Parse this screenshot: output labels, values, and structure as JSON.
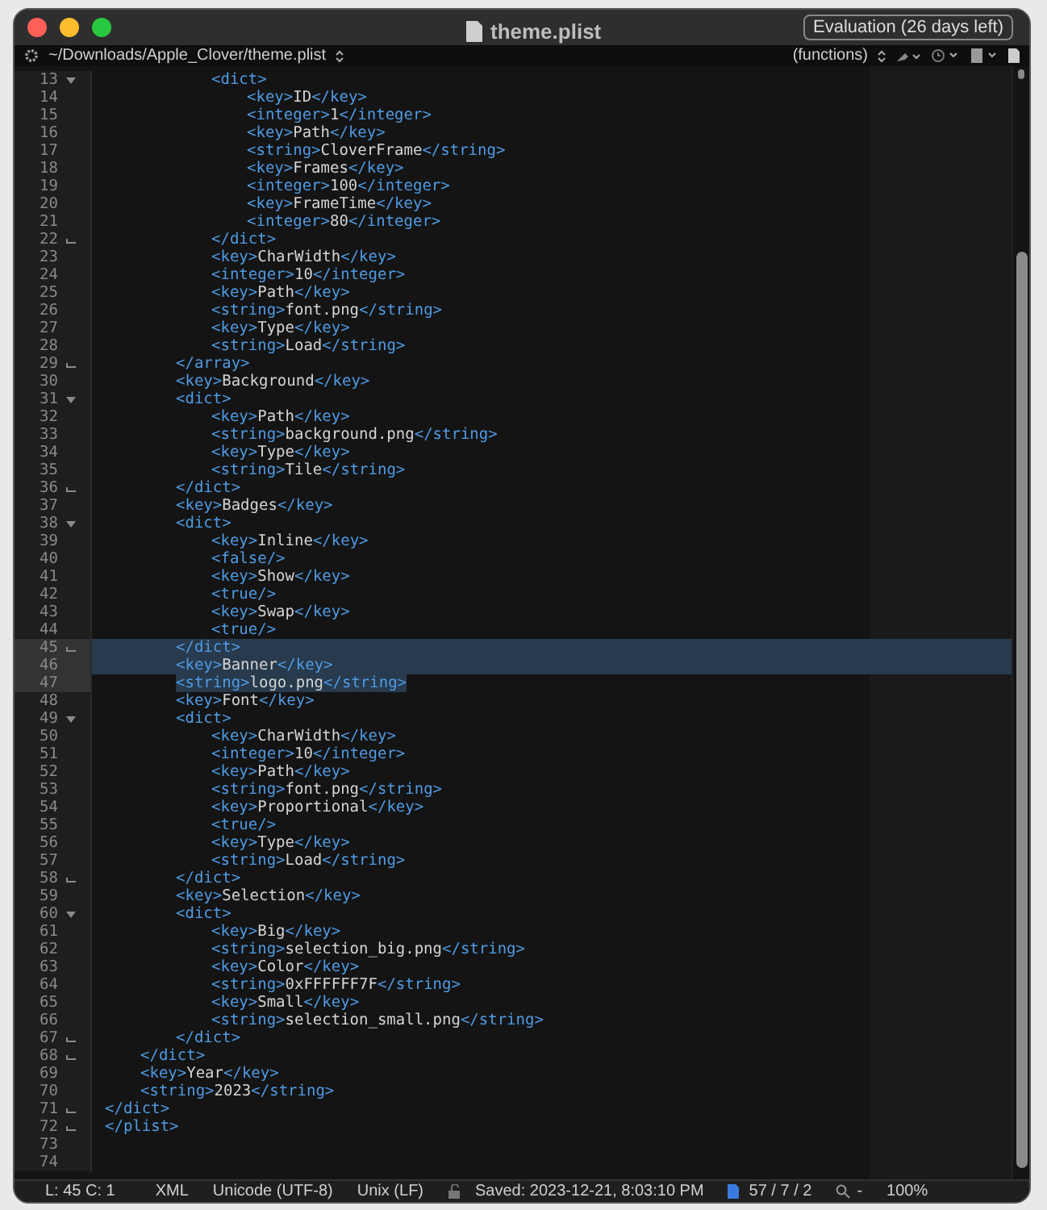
{
  "window": {
    "title": "theme.plist",
    "badge": "Evaluation (26 days left)"
  },
  "toolbar": {
    "path": "~/Downloads/Apple_Clover/theme.plist",
    "functions": "(functions)"
  },
  "lines": [
    {
      "number": "13",
      "text": "\t\t\t<dict>",
      "kind": "fold_start",
      "selected": false
    },
    {
      "number": "14",
      "text": "\t\t\t\t<key>ID</key>",
      "kind": "plain",
      "selected": false
    },
    {
      "number": "15",
      "text": "\t\t\t\t<integer>1</integer>",
      "kind": "plain",
      "selected": false
    },
    {
      "number": "16",
      "text": "\t\t\t\t<key>Path</key>",
      "kind": "plain",
      "selected": false
    },
    {
      "number": "17",
      "text": "\t\t\t\t<string>CloverFrame</string>",
      "kind": "plain",
      "selected": false
    },
    {
      "number": "18",
      "text": "\t\t\t\t<key>Frames</key>",
      "kind": "plain",
      "selected": false
    },
    {
      "number": "19",
      "text": "\t\t\t\t<integer>100</integer>",
      "kind": "plain",
      "selected": false
    },
    {
      "number": "20",
      "text": "\t\t\t\t<key>FrameTime</key>",
      "kind": "plain",
      "selected": false
    },
    {
      "number": "21",
      "text": "\t\t\t\t<integer>80</integer>",
      "kind": "plain",
      "selected": false
    },
    {
      "number": "22",
      "text": "\t\t\t</dict>",
      "kind": "fold_end",
      "selected": false
    },
    {
      "number": "23",
      "text": "\t\t\t<key>CharWidth</key>",
      "kind": "plain",
      "selected": false
    },
    {
      "number": "24",
      "text": "\t\t\t<integer>10</integer>",
      "kind": "plain",
      "selected": false
    },
    {
      "number": "25",
      "text": "\t\t\t<key>Path</key>",
      "kind": "plain",
      "selected": false
    },
    {
      "number": "26",
      "text": "\t\t\t<string>font.png</string>",
      "kind": "plain",
      "selected": false
    },
    {
      "number": "27",
      "text": "\t\t\t<key>Type</key>",
      "kind": "plain",
      "selected": false
    },
    {
      "number": "28",
      "text": "\t\t\t<string>Load</string>",
      "kind": "plain",
      "selected": false
    },
    {
      "number": "29",
      "text": "\t\t</array>",
      "kind": "fold_end",
      "selected": false
    },
    {
      "number": "30",
      "text": "\t\t<key>Background</key>",
      "kind": "plain",
      "selected": false
    },
    {
      "number": "31",
      "text": "\t\t<dict>",
      "kind": "fold_start",
      "selected": false
    },
    {
      "number": "32",
      "text": "\t\t\t<key>Path</key>",
      "kind": "plain",
      "selected": false
    },
    {
      "number": "33",
      "text": "\t\t\t<string>background.png</string>",
      "kind": "plain",
      "selected": false
    },
    {
      "number": "34",
      "text": "\t\t\t<key>Type</key>",
      "kind": "plain",
      "selected": false
    },
    {
      "number": "35",
      "text": "\t\t\t<string>Tile</string>",
      "kind": "plain",
      "selected": false
    },
    {
      "number": "36",
      "text": "\t\t</dict>",
      "kind": "fold_end",
      "selected": false
    },
    {
      "number": "37",
      "text": "\t\t<key>Badges</key>",
      "kind": "plain",
      "selected": false
    },
    {
      "number": "38",
      "text": "\t\t<dict>",
      "kind": "fold_start",
      "selected": false
    },
    {
      "number": "39",
      "text": "\t\t\t<key>Inline</key>",
      "kind": "plain",
      "selected": false
    },
    {
      "number": "40",
      "text": "\t\t\t<false/>",
      "kind": "plain",
      "selected": false
    },
    {
      "number": "41",
      "text": "\t\t\t<key>Show</key>",
      "kind": "plain",
      "selected": false
    },
    {
      "number": "42",
      "text": "\t\t\t<true/>",
      "kind": "plain",
      "selected": false
    },
    {
      "number": "43",
      "text": "\t\t\t<key>Swap</key>",
      "kind": "plain",
      "selected": false
    },
    {
      "number": "44",
      "text": "\t\t\t<true/>",
      "kind": "plain",
      "selected": false
    },
    {
      "number": "45",
      "text": "\t\t</dict>",
      "kind": "fold_end",
      "selected": true
    },
    {
      "number": "46",
      "text": "\t\t<key>Banner</key>",
      "kind": "plain",
      "selected": true
    },
    {
      "number": "47",
      "text": "\t\t<string>logo.png</string>",
      "kind": "plain",
      "selected": true
    },
    {
      "number": "48",
      "text": "\t\t<key>Font</key>",
      "kind": "plain",
      "selected": false
    },
    {
      "number": "49",
      "text": "\t\t<dict>",
      "kind": "fold_start",
      "selected": false
    },
    {
      "number": "50",
      "text": "\t\t\t<key>CharWidth</key>",
      "kind": "plain",
      "selected": false
    },
    {
      "number": "51",
      "text": "\t\t\t<integer>10</integer>",
      "kind": "plain",
      "selected": false
    },
    {
      "number": "52",
      "text": "\t\t\t<key>Path</key>",
      "kind": "plain",
      "selected": false
    },
    {
      "number": "53",
      "text": "\t\t\t<string>font.png</string>",
      "kind": "plain",
      "selected": false
    },
    {
      "number": "54",
      "text": "\t\t\t<key>Proportional</key>",
      "kind": "plain",
      "selected": false
    },
    {
      "number": "55",
      "text": "\t\t\t<true/>",
      "kind": "plain",
      "selected": false
    },
    {
      "number": "56",
      "text": "\t\t\t<key>Type</key>",
      "kind": "plain",
      "selected": false
    },
    {
      "number": "57",
      "text": "\t\t\t<string>Load</string>",
      "kind": "plain",
      "selected": false
    },
    {
      "number": "58",
      "text": "\t\t</dict>",
      "kind": "fold_end",
      "selected": false
    },
    {
      "number": "59",
      "text": "\t\t<key>Selection</key>",
      "kind": "plain",
      "selected": false
    },
    {
      "number": "60",
      "text": "\t\t<dict>",
      "kind": "fold_start",
      "selected": false
    },
    {
      "number": "61",
      "text": "\t\t\t<key>Big</key>",
      "kind": "plain",
      "selected": false
    },
    {
      "number": "62",
      "text": "\t\t\t<string>selection_big.png</string>",
      "kind": "plain",
      "selected": false
    },
    {
      "number": "63",
      "text": "\t\t\t<key>Color</key>",
      "kind": "plain",
      "selected": false
    },
    {
      "number": "64",
      "text": "\t\t\t<string>0xFFFFFF7F</string>",
      "kind": "plain",
      "selected": false
    },
    {
      "number": "65",
      "text": "\t\t\t<key>Small</key>",
      "kind": "plain",
      "selected": false
    },
    {
      "number": "66",
      "text": "\t\t\t<string>selection_small.png</string>",
      "kind": "plain",
      "selected": false
    },
    {
      "number": "67",
      "text": "\t\t</dict>",
      "kind": "fold_end",
      "selected": false
    },
    {
      "number": "68",
      "text": "\t</dict>",
      "kind": "fold_end",
      "selected": false
    },
    {
      "number": "69",
      "text": "\t<key>Year</key>",
      "kind": "plain",
      "selected": false
    },
    {
      "number": "70",
      "text": "\t<string>2023</string>",
      "kind": "plain",
      "selected": false
    },
    {
      "number": "71",
      "text": "</dict>",
      "kind": "fold_end",
      "selected": false
    },
    {
      "number": "72",
      "text": "</plist>",
      "kind": "fold_end",
      "selected": false
    },
    {
      "number": "73",
      "kind": "plain",
      "selected": false
    },
    {
      "number": "74",
      "kind": "plain",
      "selected": false
    }
  ],
  "status_bar": {
    "position": "L: 45 C: 1",
    "syntax": "XML",
    "encoding": "Unicode (UTF-8)",
    "line_endings": "Unix (LF)",
    "saved": "Saved: 2023-12-21, 8:03:10 PM",
    "counts": "57 / 7 / 2",
    "search": "-",
    "zoom": "100%"
  }
}
